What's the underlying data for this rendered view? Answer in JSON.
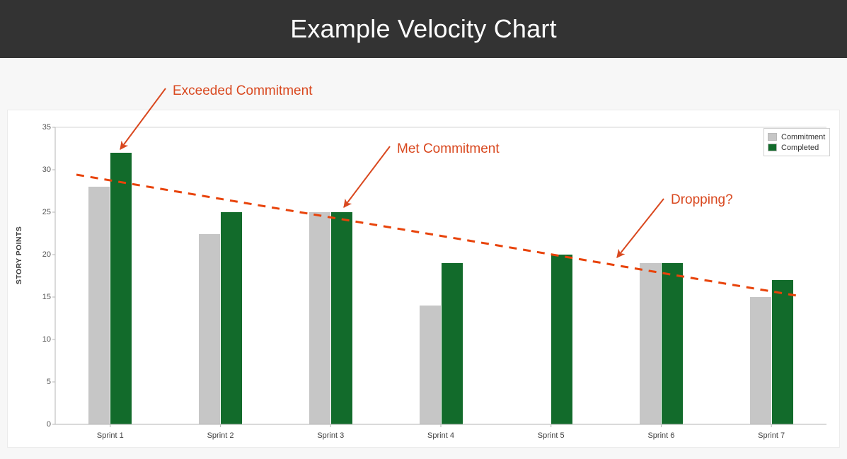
{
  "header": {
    "title": "Example Velocity Chart",
    "background_color": "#333333",
    "text_color": "#ffffff"
  },
  "colors": {
    "commitment": "#c6c6c6",
    "completed": "#126B2B",
    "annotation": "#D9481F",
    "trendline": "#E8430A",
    "panel_background": "#ffffff",
    "slide_background": "#f7f7f7"
  },
  "legend": {
    "position": "top-right",
    "items": [
      {
        "label": "Commitment",
        "color": "#c6c6c6"
      },
      {
        "label": "Completed",
        "color": "#126B2B"
      }
    ]
  },
  "annotations": [
    {
      "text": "Exceeded Commitment",
      "target": "sprint-1-completed-bar"
    },
    {
      "text": "Met Commitment",
      "target": "sprint-3-completed-bar"
    },
    {
      "text": "Dropping?",
      "target": "trendline"
    }
  ],
  "chart_data": {
    "type": "bar",
    "title": "Example Velocity Chart",
    "xlabel": "",
    "ylabel": "STORY POINTS",
    "categories": [
      "Sprint 1",
      "Sprint 2",
      "Sprint 3",
      "Sprint 4",
      "Sprint 5",
      "Sprint 6",
      "Sprint 7"
    ],
    "series": [
      {
        "name": "Commitment",
        "color": "#c6c6c6",
        "values": [
          28,
          22.4,
          25,
          14,
          0,
          19,
          15
        ]
      },
      {
        "name": "Completed",
        "color": "#126B2B",
        "values": [
          32,
          25,
          25,
          19,
          20,
          19,
          17
        ]
      }
    ],
    "ylim": [
      0,
      35
    ],
    "yticks": [
      0,
      5,
      10,
      15,
      20,
      25,
      30,
      35
    ],
    "ytick_labels": [
      "0",
      "5",
      "10",
      "15",
      "20",
      "25",
      "30",
      "35"
    ],
    "grid": false,
    "legend_position": "upper right",
    "trendline": {
      "style": "dashed",
      "color": "#E8430A",
      "start_value": 29.4,
      "end_value": 15.2,
      "description": "Downward dashed trend line across all sprints"
    }
  }
}
